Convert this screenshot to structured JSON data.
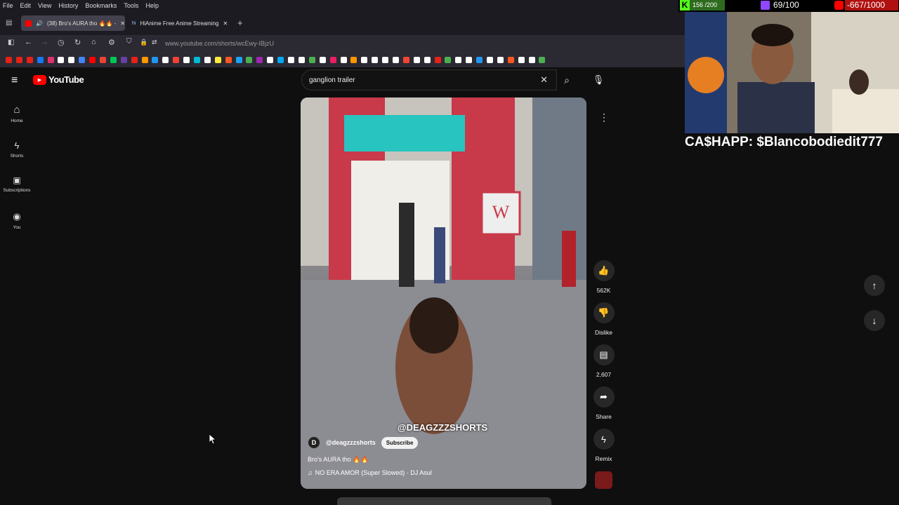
{
  "browser": {
    "menu": [
      "File",
      "Edit",
      "View",
      "History",
      "Bookmarks",
      "Tools",
      "Help"
    ],
    "tabs": [
      {
        "label": "(38) Bro's AURA tho 🔥🔥 -",
        "active": true
      },
      {
        "label": "HiAnime Free Anime Streaming",
        "active": false
      }
    ],
    "url": "www.youtube.com/shorts/wcEwy-IBjzU",
    "bookmark_colors": [
      "#e62117",
      "#e62117",
      "#e62117",
      "#1877f2",
      "#e1306c",
      "#ffffff",
      "#ffffff",
      "#4285f4",
      "#ff0000",
      "#ea4335",
      "#00c853",
      "#6441a5",
      "#e62117",
      "#ff9800",
      "#2196f3",
      "#ffffff",
      "#f44336",
      "#ffffff",
      "#00bcd4",
      "#ffffff",
      "#ffeb3b",
      "#ff5722",
      "#1da1f2",
      "#4caf50",
      "#9c27b0",
      "#ffffff",
      "#03a9f4",
      "#ffffff",
      "#ffffff",
      "#4caf50",
      "#ffffff",
      "#e91e63",
      "#ffffff",
      "#ff9800",
      "#ffffff",
      "#ffffff",
      "#ffffff",
      "#ffffff",
      "#f44336",
      "#ffffff",
      "#ffffff",
      "#e62117",
      "#4caf50",
      "#ffffff",
      "#ffffff",
      "#2196f3",
      "#ffffff",
      "#ffffff",
      "#ff5722",
      "#ffffff",
      "#ffffff",
      "#4caf50"
    ]
  },
  "youtube": {
    "logo": "YouTube",
    "nav": [
      {
        "label": "Home",
        "icon": "home-icon"
      },
      {
        "label": "Shorts",
        "icon": "shorts-icon"
      },
      {
        "label": "Subscriptions",
        "icon": "subscriptions-icon"
      },
      {
        "label": "You",
        "icon": "you-icon"
      }
    ],
    "search_value": "ganglion trailer",
    "video": {
      "watermark": "@DEAGZZZSHORTS",
      "channel": "@deagzzzshorts",
      "channel_initial": "D",
      "subscribe": "Subscribe",
      "title": "Bro's AURA tho 🔥🔥",
      "music": "NO ERA AMOR (Super Slowed) · DJ Asul"
    },
    "actions": {
      "likes": "562K",
      "dislike": "Dislike",
      "comments": "2,607",
      "share": "Share",
      "remix": "Remix"
    }
  },
  "overlay": {
    "kick": "156 /200",
    "twitch": "69/100",
    "youtube_goal": "-667/1000",
    "cashapp": "CA$HAPP: $Blancobodiedit777"
  },
  "colors": {
    "accent": "#ff0000",
    "subscribe_bg": "#f1f1f1",
    "kick": "#53fc18",
    "twitch": "#9146ff"
  }
}
